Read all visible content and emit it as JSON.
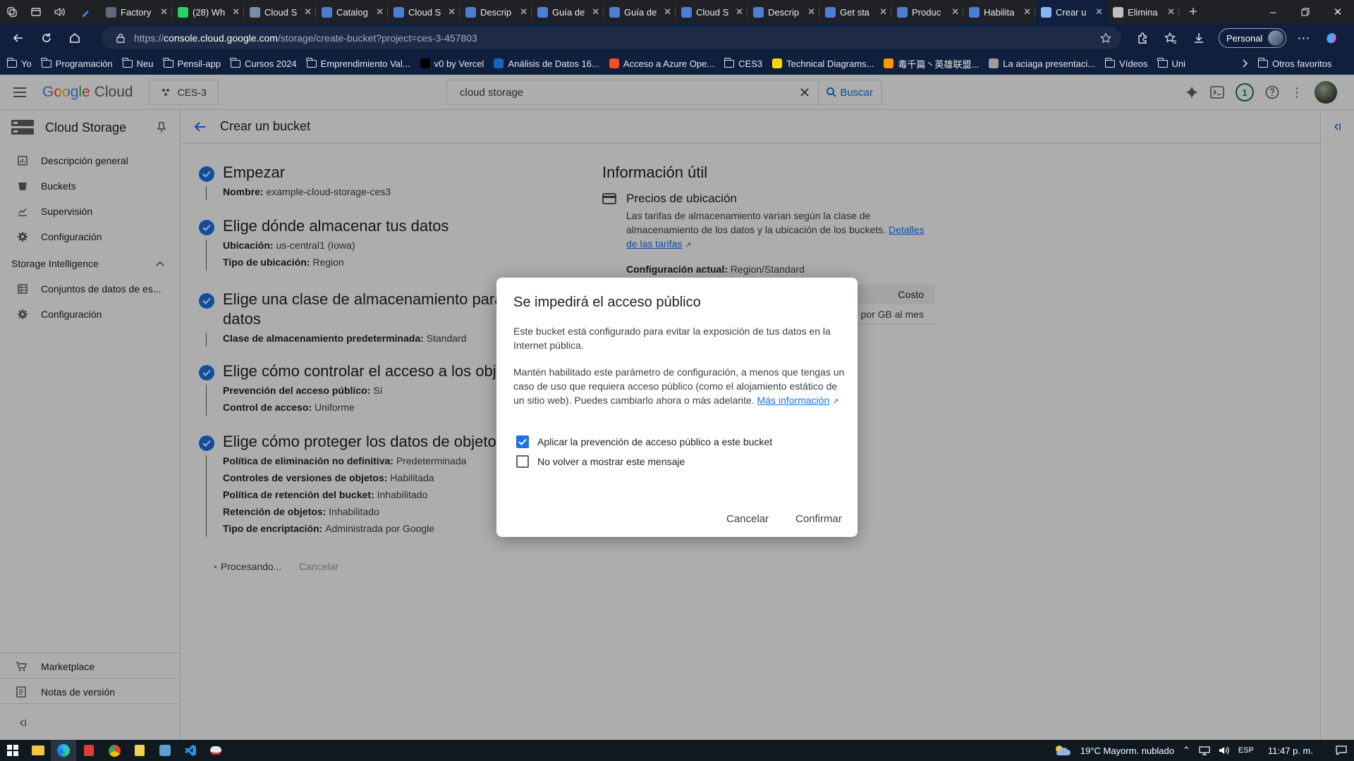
{
  "browser": {
    "tabs": [
      {
        "title": "Factory",
        "color": "#5f6a7a"
      },
      {
        "title": "(28) Wh",
        "color": "#25d366"
      },
      {
        "title": "Cloud S",
        "color": "#7a8ca8"
      },
      {
        "title": "Catalog",
        "color": "#4a7fd4"
      },
      {
        "title": "Cloud S",
        "color": "#4a7fd4"
      },
      {
        "title": "Descrip",
        "color": "#4a7fd4"
      },
      {
        "title": "Guía de",
        "color": "#4a7fd4"
      },
      {
        "title": "Guía de",
        "color": "#4a7fd4"
      },
      {
        "title": "Cloud S",
        "color": "#4a7fd4"
      },
      {
        "title": "Descrip",
        "color": "#4a7fd4"
      },
      {
        "title": "Get sta",
        "color": "#4a7fd4"
      },
      {
        "title": "Produc",
        "color": "#4a7fd4"
      },
      {
        "title": "Habilita",
        "color": "#4a7fd4"
      },
      {
        "title": "Crear u",
        "color": "#8ab4f8"
      },
      {
        "title": "Elimina",
        "color": "#c0c0c0"
      }
    ],
    "address": {
      "prefix": "https://",
      "host": "console.cloud.google.com",
      "path": "/storage/create-bucket?project=ces-3-457803"
    },
    "profile_label": "Personal",
    "bookmarks": [
      {
        "label": "Yo",
        "type": "folder"
      },
      {
        "label": "Programación",
        "type": "folder"
      },
      {
        "label": "Neu",
        "type": "folder"
      },
      {
        "label": "Pensil-app",
        "type": "folder"
      },
      {
        "label": "Cursos 2024",
        "type": "folder"
      },
      {
        "label": "Emprendimiento Val...",
        "type": "folder"
      },
      {
        "label": "v0 by Vercel",
        "type": "site",
        "color": "#000000"
      },
      {
        "label": "Análisis de Datos 16...",
        "type": "site",
        "color": "#1565c0"
      },
      {
        "label": "Acceso a Azure Ope...",
        "type": "site",
        "color": "#f25022"
      },
      {
        "label": "CES3",
        "type": "folder"
      },
      {
        "label": "Technical Diagrams...",
        "type": "site",
        "color": "#ffd600"
      },
      {
        "label": "毒千篇丶英雄联盟...",
        "type": "site",
        "color": "#ff9800"
      },
      {
        "label": "La aciaga presentaci...",
        "type": "site",
        "color": "#9e9e9e"
      },
      {
        "label": "Vídeos",
        "type": "folder"
      },
      {
        "label": "Uni",
        "type": "folder"
      }
    ],
    "other_bookmarks": "Otros favoritos"
  },
  "gcp": {
    "logo_google": "Google",
    "logo_cloud": "Cloud",
    "project": "CES-3",
    "search_value": "cloud storage",
    "search_button": "Buscar",
    "notification_count": "1"
  },
  "sidebar": {
    "product": "Cloud Storage",
    "items": [
      "Descripción general",
      "Buckets",
      "Supervisión",
      "Configuración"
    ],
    "section": "Storage Intelligence",
    "section_items": [
      "Conjuntos de datos de es...",
      "Configuración"
    ],
    "bottom_items": [
      "Marketplace",
      "Notas de versión"
    ]
  },
  "page": {
    "title": "Crear un bucket",
    "steps": [
      {
        "title": "Empezar",
        "lines": [
          {
            "k": "Nombre",
            "v": "example-cloud-storage-ces3"
          }
        ]
      },
      {
        "title": "Elige dónde almacenar tus datos",
        "lines": [
          {
            "k": "Ubicación",
            "v": "us-central1 (Iowa)"
          },
          {
            "k": "Tipo de ubicación",
            "v": "Region"
          }
        ]
      },
      {
        "title": "Elige una clase de almacenamiento para tus",
        "title2": "datos",
        "lines": [
          {
            "k": "Clase de almacenamiento predeterminada",
            "v": "Standard"
          }
        ]
      },
      {
        "title": "Elige cómo controlar el acceso a los objetos",
        "lines": [
          {
            "k": "Prevención del acceso público",
            "v": "Sí"
          },
          {
            "k": "Control de acceso",
            "v": "Uniforme"
          }
        ]
      },
      {
        "title": "Elige cómo proteger los datos de objetos",
        "lines": [
          {
            "k": "Política de eliminación no definitiva",
            "v": "Predeterminada"
          },
          {
            "k": "Controles de versiones de objetos",
            "v": "Habilitada"
          },
          {
            "k": "Política de retención del bucket",
            "v": "Inhabilitado"
          },
          {
            "k": "Retención de objetos",
            "v": "Inhabilitado"
          },
          {
            "k": "Tipo de encriptación",
            "v": "Administrada por Google"
          }
        ]
      }
    ],
    "processing": "Procesando...",
    "cancel": "Cancelar"
  },
  "info": {
    "heading": "Información útil",
    "pricing_title": "Precios de ubicación",
    "pricing_text": "Las tarifas de almacenamiento varían según la clase de almacenamiento de los datos y la ubicación de los buckets.",
    "pricing_link": "Detalles de las tarifas",
    "current_config_label": "Configuración actual",
    "current_config_value": "Region/Standard",
    "table_header_cost": "Costo",
    "table_cost_value": "$0.020 por GB al mes"
  },
  "dialog": {
    "title": "Se impedirá el acceso público",
    "p1": "Este bucket está configurado para evitar la exposición de tus datos en la Internet pública.",
    "p2": "Mantén habilitado este parámetro de configuración, a menos que tengas un caso de uso que requiera acceso público (como el alojamiento estático de un sitio web). Puedes cambiarlo ahora o más adelante.",
    "link": "Más información",
    "checkbox1": "Aplicar la prevención de acceso público a este bucket",
    "checkbox1_checked": true,
    "checkbox2": "No volver a mostrar este mensaje",
    "checkbox2_checked": false,
    "cancel": "Cancelar",
    "confirm": "Confirmar"
  },
  "taskbar": {
    "weather": "19°C  Mayorm. nublado",
    "lang": "ESP",
    "time": "11:47 p. m."
  }
}
